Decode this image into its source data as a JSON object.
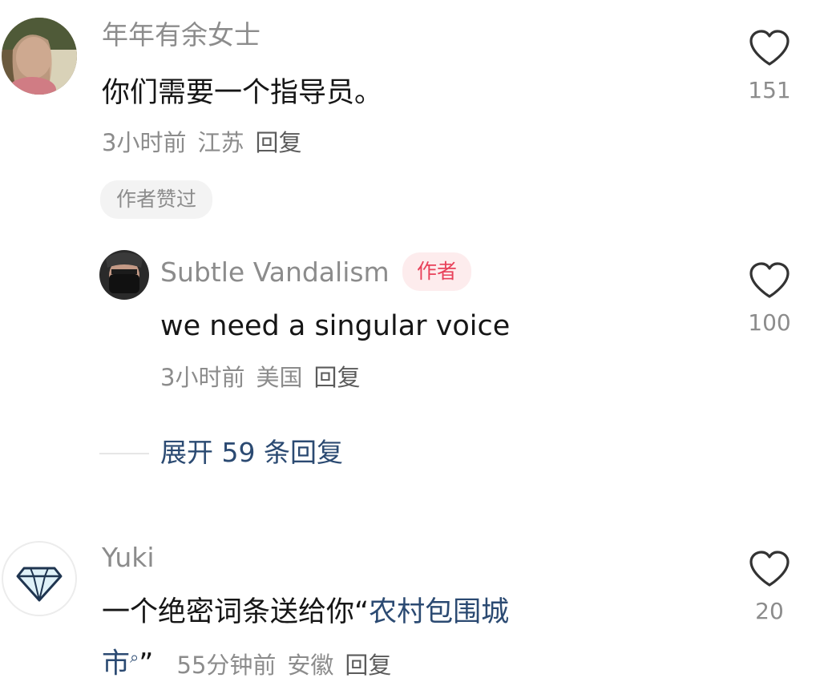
{
  "comments": [
    {
      "username": "年年有余女士",
      "text": "你们需要一个指导员。",
      "time": "3小时前",
      "location": "江苏",
      "reply_label": "回复",
      "liked_tag": "作者赞过",
      "like_count": "151",
      "replies": [
        {
          "username": "Subtle Vandalism",
          "author_tag": "作者",
          "text": "we need a singular voice",
          "time": "3小时前",
          "location": "美国",
          "reply_label": "回复",
          "like_count": "100"
        }
      ],
      "expand_label": "展开 59 条回复"
    },
    {
      "username": "Yuki",
      "text_line1": "一个绝密词条送给你“",
      "hashtag_part1": "农村包围城",
      "hashtag_part2": "市",
      "text_end": "”",
      "time": "55分钟前",
      "location": "安徽",
      "reply_label": "回复",
      "like_count": "20"
    }
  ],
  "icons": {
    "like": "heart-outline-icon",
    "search": "search-icon",
    "diamond": "diamond-icon"
  },
  "colors": {
    "author_tag_text": "#e8415a",
    "author_tag_bg": "#fdeced",
    "link": "#2b4a72",
    "meta": "#8c8c8c"
  }
}
